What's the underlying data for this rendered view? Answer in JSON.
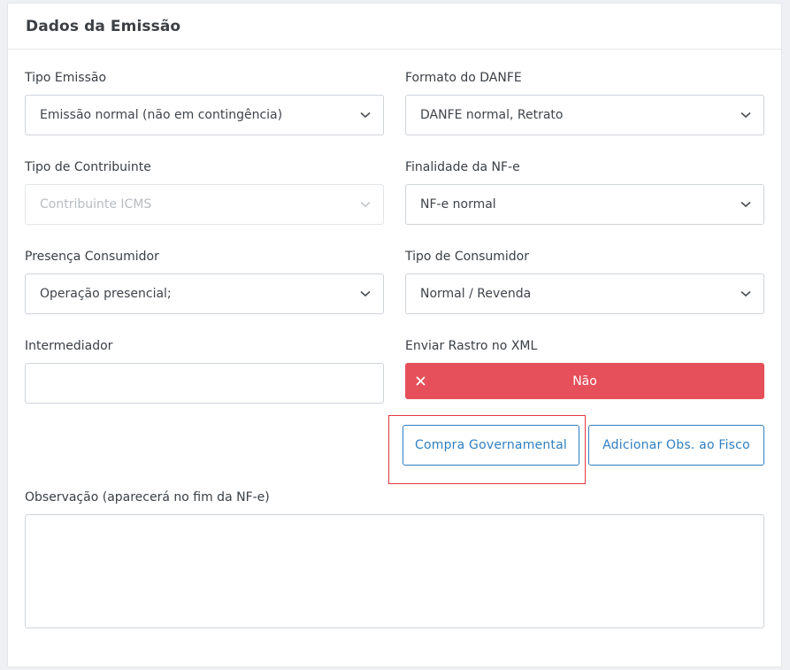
{
  "card": {
    "title": "Dados da Emissão"
  },
  "fields": {
    "tipo_emissao": {
      "label": "Tipo Emissão",
      "value": "Emissão normal (não em contingência)"
    },
    "formato_danfe": {
      "label": "Formato do DANFE",
      "value": "DANFE normal, Retrato"
    },
    "tipo_contribuinte": {
      "label": "Tipo de Contribuinte",
      "value": "Contribuinte ICMS",
      "disabled": true
    },
    "finalidade_nfe": {
      "label": "Finalidade da NF-e",
      "value": "NF-e normal"
    },
    "presenca_consumidor": {
      "label": "Presença Consumidor",
      "value": "Operação presencial;"
    },
    "tipo_consumidor": {
      "label": "Tipo de Consumidor",
      "value": "Normal / Revenda"
    },
    "intermediador": {
      "label": "Intermediador",
      "value": ""
    },
    "enviar_rastro": {
      "label": "Enviar Rastro no XML",
      "value": "Não",
      "icon": "close-icon",
      "color": "#e5505a"
    },
    "observacao": {
      "label": "Observação (aparecerá no fim da NF-e)",
      "value": ""
    }
  },
  "buttons": {
    "compra_governamental": "Compra Governamental",
    "adicionar_obs_fisco": "Adicionar Obs. ao Fisco"
  },
  "colors": {
    "accent": "#2f7fc1",
    "danger": "#e5505a",
    "highlight": "#e0393f"
  }
}
